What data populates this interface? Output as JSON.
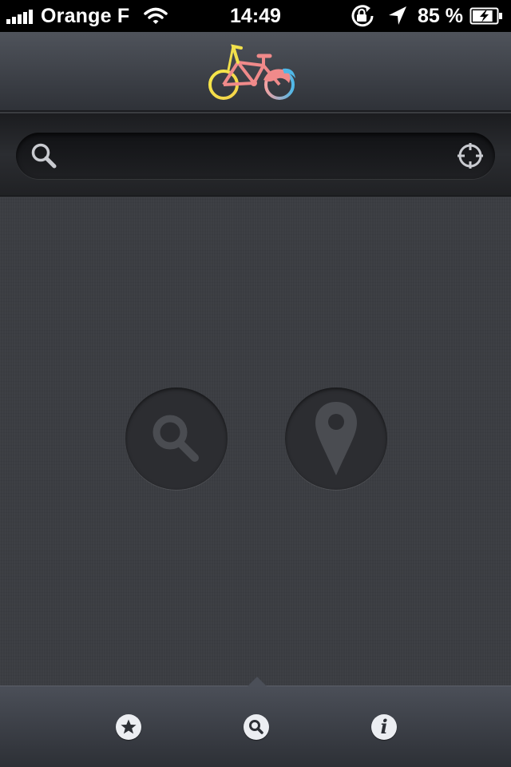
{
  "status_bar": {
    "carrier": "Orange F",
    "time": "14:49",
    "battery_percent": "85 %",
    "battery_level": 0.85,
    "icons": [
      "signal-icon",
      "wifi-icon",
      "rotation-lock-icon",
      "location-arrow-icon",
      "battery-charging-icon"
    ]
  },
  "nav_bar": {
    "logo": "bicycle-logo-icon"
  },
  "search": {
    "value": "",
    "placeholder": "",
    "left_icon": "magnifier-icon",
    "right_icon": "crosshair-locate-icon"
  },
  "main": {
    "buttons": [
      {
        "icon": "magnifier-icon"
      },
      {
        "icon": "map-pin-icon"
      }
    ]
  },
  "tab_bar": {
    "selected": "search",
    "tabs": [
      {
        "icon": "star-icon"
      },
      {
        "icon": "magnifier-icon",
        "selected": true
      },
      {
        "icon": "info-icon",
        "glyph": "i"
      }
    ]
  },
  "colors": {
    "background": "#3a3c40",
    "bar_top": "#4f535b",
    "bar_bottom": "#2f3238",
    "logo_yellow": "#f2e14c",
    "logo_pink": "#f08a8a",
    "logo_blue": "#4fb8e8"
  }
}
